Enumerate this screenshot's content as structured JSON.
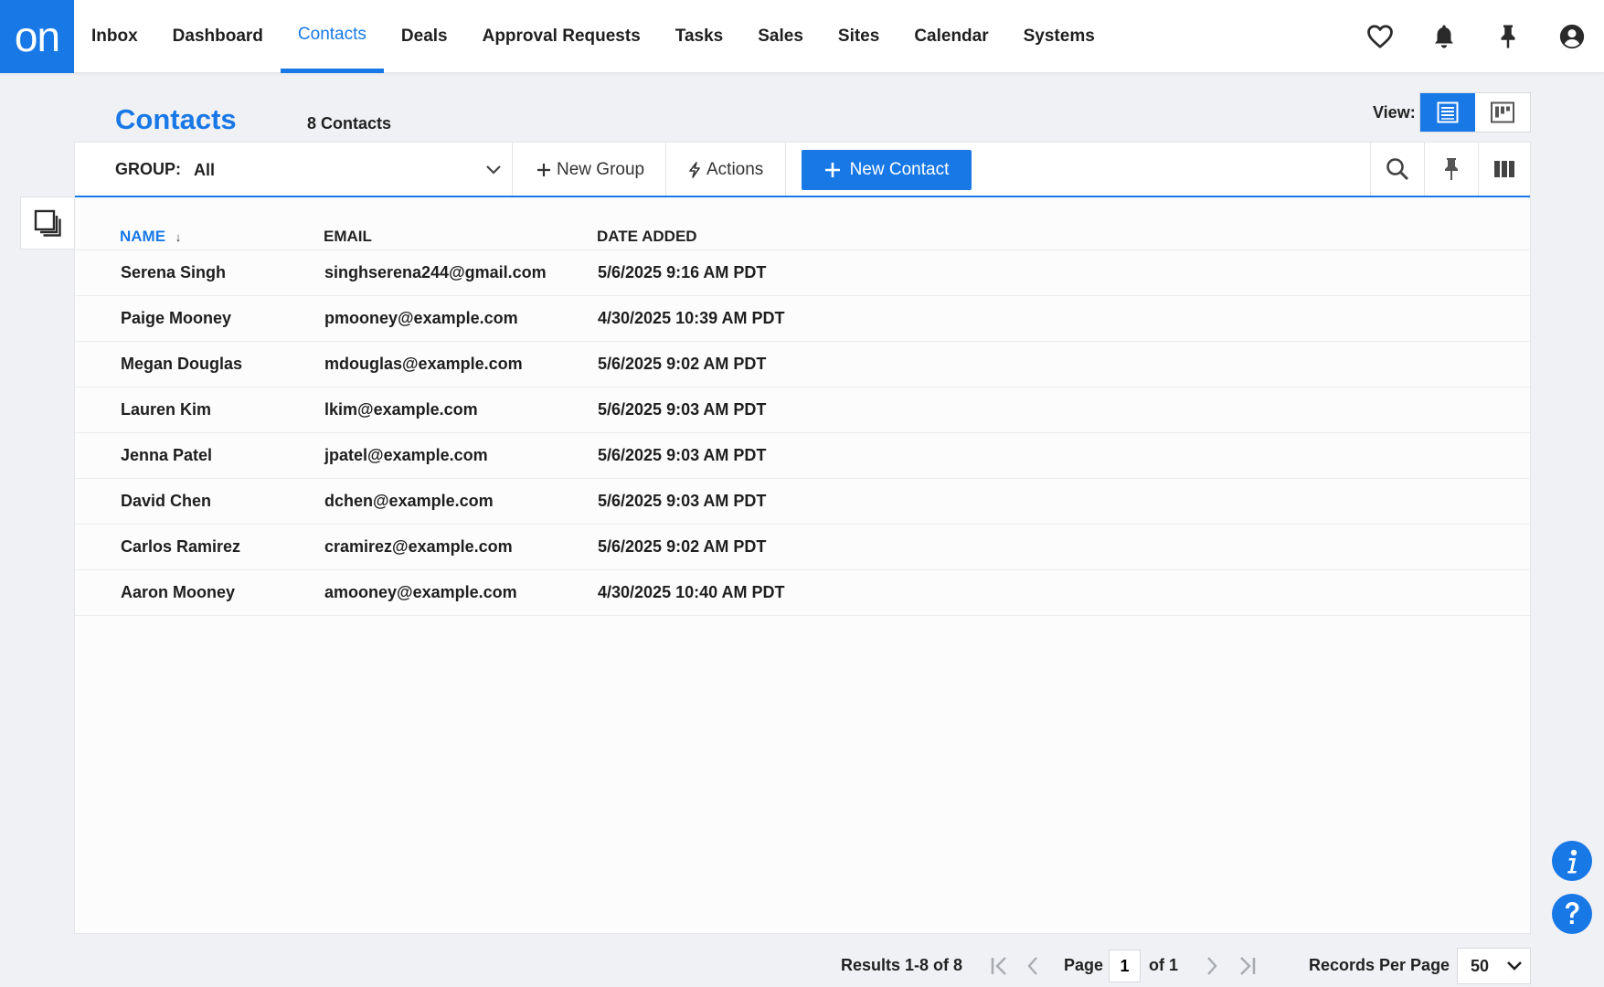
{
  "nav": {
    "logo": "on",
    "items": [
      {
        "label": "Inbox"
      },
      {
        "label": "Dashboard"
      },
      {
        "label": "Contacts",
        "active": true
      },
      {
        "label": "Deals"
      },
      {
        "label": "Approval Requests"
      },
      {
        "label": "Tasks"
      },
      {
        "label": "Sales"
      },
      {
        "label": "Sites"
      },
      {
        "label": "Calendar"
      },
      {
        "label": "Systems"
      }
    ],
    "icons": [
      "heart-icon",
      "bell-icon",
      "pin-icon",
      "account-icon"
    ]
  },
  "page": {
    "title": "Contacts",
    "count": "8 Contacts",
    "view_label": "View:"
  },
  "toolbar": {
    "group_label": "GROUP:",
    "group_value": "All",
    "new_group": "New Group",
    "actions": "Actions",
    "new_contact": "New Contact"
  },
  "table": {
    "columns": [
      "NAME",
      "EMAIL",
      "DATE ADDED"
    ],
    "sort_indicator": "↓",
    "rows": [
      {
        "name": "Serena Singh",
        "email": "singhserena244@gmail.com",
        "date": "5/6/2025 9:16 AM PDT"
      },
      {
        "name": "Paige Mooney",
        "email": "pmooney@example.com",
        "date": "4/30/2025 10:39 AM PDT"
      },
      {
        "name": "Megan Douglas",
        "email": "mdouglas@example.com",
        "date": "5/6/2025 9:02 AM PDT"
      },
      {
        "name": "Lauren Kim",
        "email": "lkim@example.com",
        "date": "5/6/2025 9:03 AM PDT"
      },
      {
        "name": "Jenna Patel",
        "email": "jpatel@example.com",
        "date": "5/6/2025 9:03 AM PDT"
      },
      {
        "name": "David Chen",
        "email": "dchen@example.com",
        "date": "5/6/2025 9:03 AM PDT"
      },
      {
        "name": "Carlos Ramirez",
        "email": "cramirez@example.com",
        "date": "5/6/2025 9:02 AM PDT"
      },
      {
        "name": "Aaron Mooney",
        "email": "amooney@example.com",
        "date": "4/30/2025 10:40 AM PDT"
      }
    ]
  },
  "pagination": {
    "results": "Results 1-8  of  8",
    "page_label": "Page",
    "page_value": "1",
    "of_label": "of  1",
    "rpp_label": "Records Per Page",
    "rpp_value": "50"
  },
  "colors": {
    "accent": "#1878e6"
  }
}
